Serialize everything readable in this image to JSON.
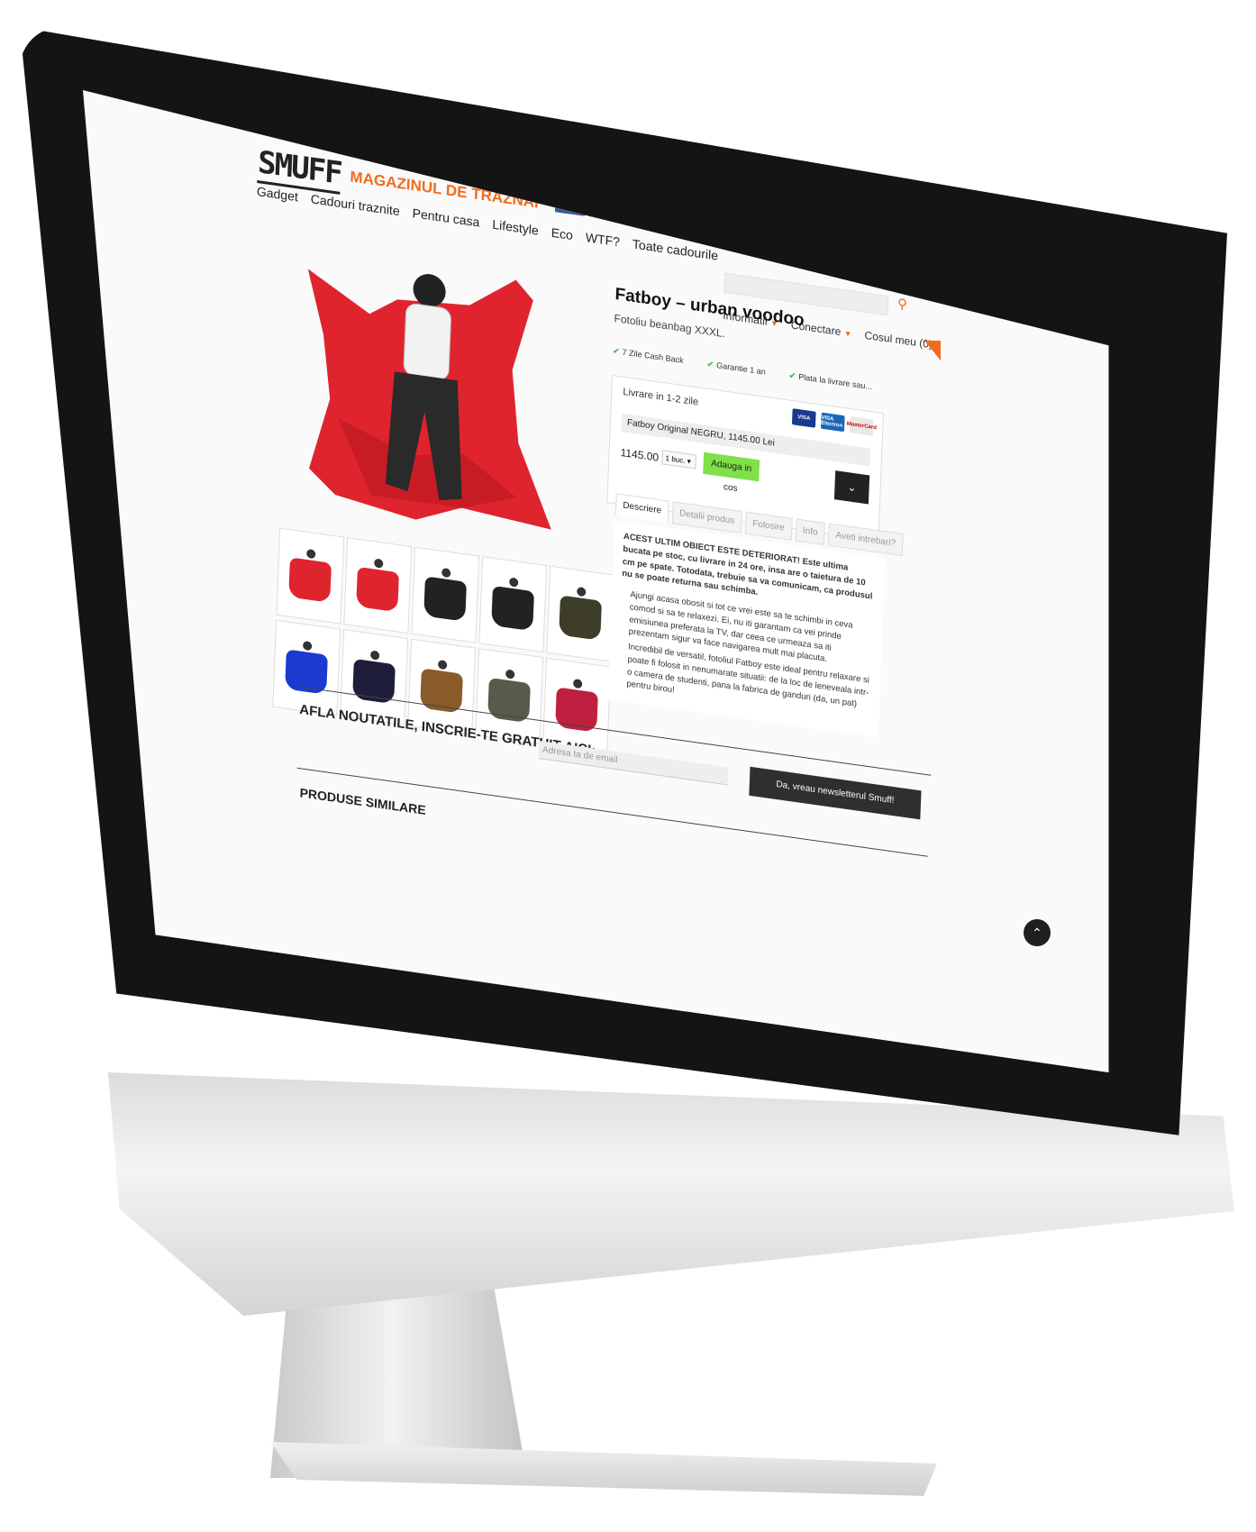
{
  "brand": {
    "logo_text": "SMUFF",
    "tagline": "MAGAZINUL DE TRAZNAI",
    "fb_like": "Like",
    "fb_count": "12k"
  },
  "nav": [
    "Gadget",
    "Cadouri traznite",
    "Pentru casa",
    "Lifestyle",
    "Eco",
    "WTF?",
    "Toate cadourile"
  ],
  "account": {
    "info": "Informatii",
    "login": "Conectare",
    "cart": "Cosul meu (0)"
  },
  "product": {
    "title": "Fatboy – urban voodoo",
    "subtitle": "Fotoliu beanbag XXXL.",
    "perks": [
      "7 Zile Cash Back",
      "Garantie 1 an",
      "Plata la livrare sau..."
    ],
    "delivery": "Livrare in 1-2 zile",
    "cards": [
      {
        "label": "VISA",
        "color": "#1a3a8f"
      },
      {
        "label": "VISA Electron",
        "color": "#1a66b8"
      },
      {
        "label": "MasterCard",
        "color": "#e8e8e8"
      }
    ],
    "variant": "Fatboy Original NEGRU, 1145.00 Lei",
    "price": "1145.00 Lei",
    "qty": "1 buc.",
    "add_to_cart": "Adauga in cos",
    "accent": "#f26b1d",
    "bag_color": "#e0242e"
  },
  "tabs": [
    "Descriere",
    "Detalii produs",
    "Folosire",
    "Info",
    "Aveti intrebari?"
  ],
  "description": {
    "warning": "ACEST ULTIM OBIECT ESTE DETERIORAT! Este ultima bucata pe stoc, cu livrare in 24 ore, insa are o taietura de 10 cm pe spate. Totodata, trebuie sa va comunicam, ca produsul nu se poate returna sau schimba.",
    "p1": "Ajungi acasa obosit si tot ce vrei este sa te schimbi in ceva comod si sa te relaxezi. Ei, nu iti garantam ca vei prinde emisiunea preferata la TV, dar ceea ce urmeaza sa iti prezentam sigur va face navigarea mult mai placuta.",
    "p2": "Incredibil de versatil, fotoliul Fatboy este ideal pentru relaxare si poate fi folosit in nenumarate situatii: de la loc de leneveala intr-o camera de studenti, pana la fabrica de ganduri (da, un pat) pentru birou!"
  },
  "newsletter": {
    "title": "AFLA NOUTATILE, INSCRIE-TE GRATUIT AICI:",
    "placeholder": "Adresa ta de email",
    "button": "Da, vreau newsletterul Smuff!"
  },
  "similar": {
    "title": "PRODUSE SIMILARE"
  },
  "thumbs": [
    {
      "name": "thumb-red-sitting",
      "color": "#e0242e"
    },
    {
      "name": "thumb-red-table",
      "color": "#e0242e"
    },
    {
      "name": "thumb-black-lounging",
      "color": "#222222"
    },
    {
      "name": "thumb-black-kneeling",
      "color": "#222222"
    },
    {
      "name": "thumb-olive-reclining",
      "color": "#3d3d2a"
    },
    {
      "name": "thumb-blue",
      "color": "#1a3ad0"
    },
    {
      "name": "thumb-navy-standing",
      "color": "#1e1e3a"
    },
    {
      "name": "thumb-stack",
      "color": "#8a5a2a"
    },
    {
      "name": "thumb-grey-sitting",
      "color": "#5a5a4a"
    },
    {
      "name": "thumb-pink",
      "color": "#c02040"
    }
  ]
}
